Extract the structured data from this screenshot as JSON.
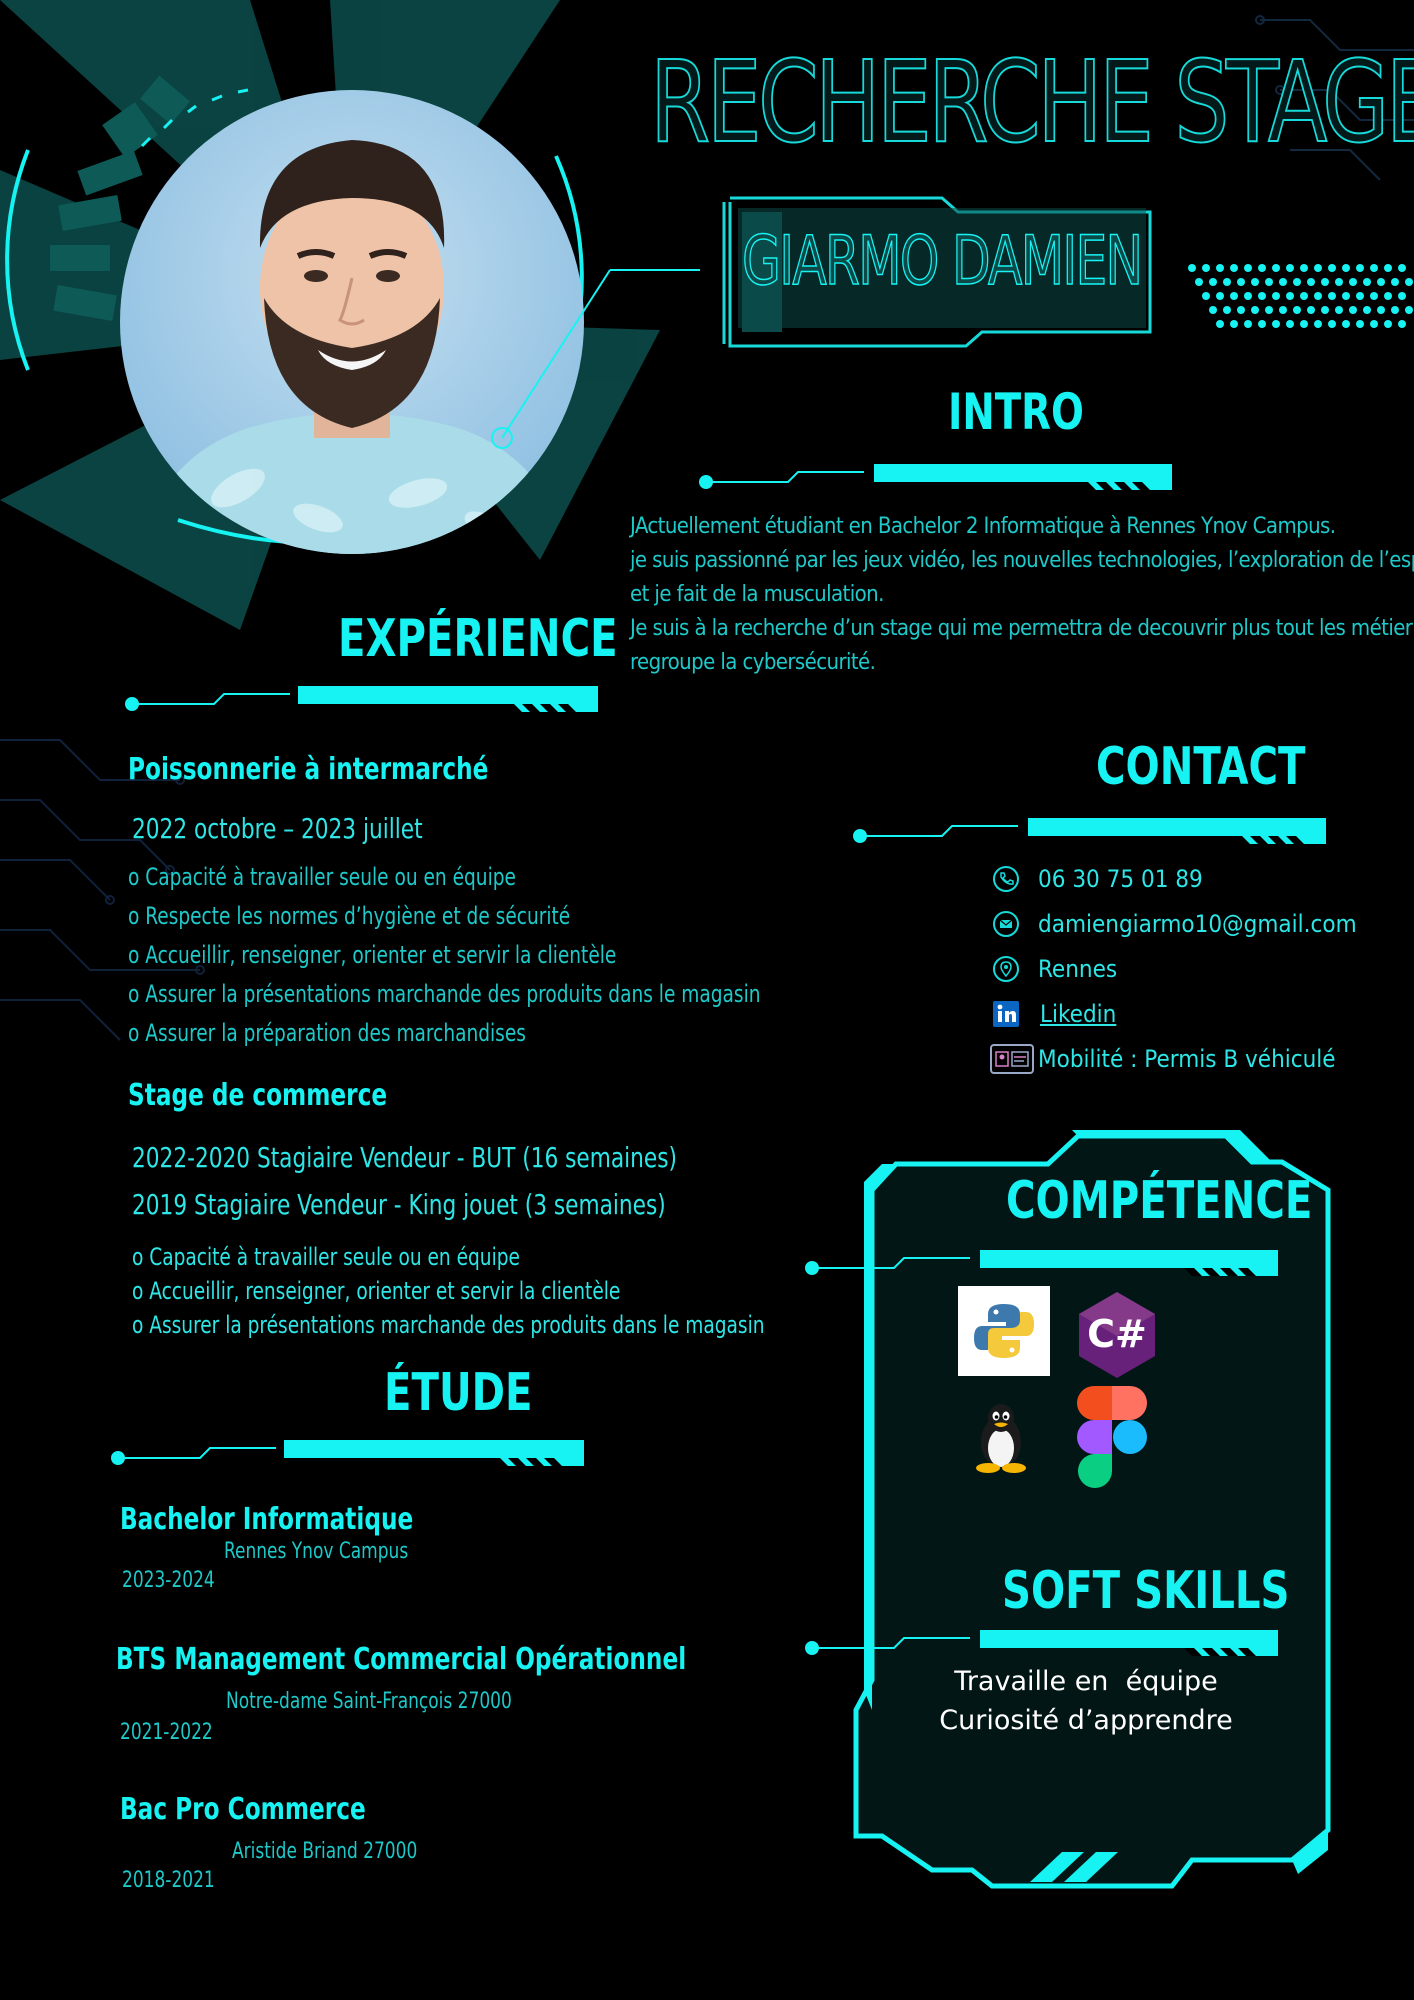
{
  "header": {
    "title": "RECHERCHE STAGE",
    "name": "GIARMO DAMIEN"
  },
  "intro": {
    "heading": "INTRO",
    "lines": [
      "JActuellement étudiant en Bachelor 2 Informatique à Rennes Ynov Campus.",
      "je suis passionné par les jeux vidéo, les nouvelles technologies, l’exploration de l’espace",
      "et je fait de la musculation.",
      "Je suis à la recherche d’un stage qui me permettra de decouvrir plus tout les métier qui",
      "regroupe la cybersécurité."
    ]
  },
  "experience": {
    "heading": "EXPÉRIENCE",
    "job1": {
      "title": "Poissonnerie à intermarché",
      "dates": "2022 octobre – 2023 juillet",
      "bullets": [
        "o Capacité à travailler seule ou en équipe",
        "o Respecte les normes d’hygiène et de sécurité",
        "o Accueillir, renseigner, orienter et servir la clientèle",
        "o Assurer la présentations marchande des produits dans le magasin",
        "o Assurer la préparation des marchandises"
      ]
    },
    "job2": {
      "title": "Stage de commerce",
      "dates": [
        "2022-2020 Stagiaire Vendeur - BUT (16 semaines)",
        "2019 Stagiaire Vendeur - King jouet (3 semaines)"
      ],
      "bullets": [
        "o Capacité à travailler seule ou en équipe",
        "o Accueillir, renseigner, orienter et servir la clientèle",
        "o Assurer la présentations marchande des produits dans le magasin"
      ]
    }
  },
  "education": {
    "heading": "ÉTUDE",
    "items": [
      {
        "title": "Bachelor Informatique",
        "school": "Rennes Ynov Campus",
        "years": "2023-2024"
      },
      {
        "title": "BTS Management Commercial Opérationnel",
        "school": "Notre-dame Saint-François 27000",
        "years": "2021-2022"
      },
      {
        "title": "Bac Pro Commerce",
        "school": "Aristide Briand 27000",
        "years": "2018-2021"
      }
    ]
  },
  "contact": {
    "heading": "CONTACT",
    "phone": "06 30 75 01 89",
    "email": "damiengiarmo10@gmail.com",
    "city": "Rennes",
    "linkedin": "Likedin",
    "mobility": "Mobilité : Permis B véhiculé",
    "icons": [
      "phone-icon",
      "email-icon",
      "location-icon",
      "linkedin-icon",
      "id-card-icon"
    ]
  },
  "skills": {
    "heading": "COMPÉTENCE",
    "csharp_label": "C#",
    "logos": [
      "python-logo",
      "csharp-logo",
      "linux-tux-logo",
      "figma-logo"
    ]
  },
  "soft_skills": {
    "heading": "SOFT SKILLS",
    "items": [
      "Travaille en  équipe",
      "Curiosité d’apprendre"
    ]
  },
  "colors": {
    "accent": "#17f2f2",
    "background": "#000000",
    "panel": "#031616"
  }
}
